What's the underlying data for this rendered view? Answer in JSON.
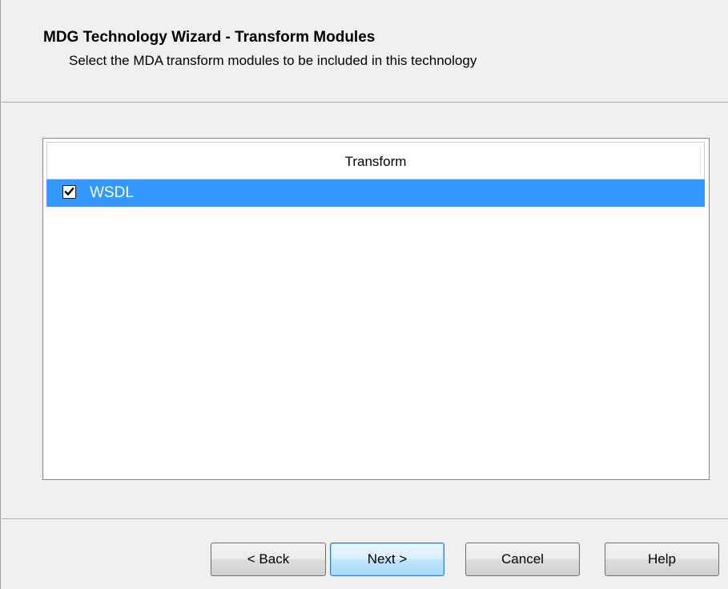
{
  "wizard": {
    "title": "MDG Technology Wizard - Transform Modules",
    "subtitle": "Select the MDA transform modules to be included in this technology"
  },
  "transform_list": {
    "column_header": "Transform",
    "items": [
      {
        "label": "WSDL",
        "checked": true,
        "selected": true
      }
    ]
  },
  "buttons": {
    "back": "< Back",
    "next": "Next >",
    "cancel": "Cancel",
    "help": "Help"
  },
  "colors": {
    "selection": "#3399ff",
    "window_bg": "#f0f0f0"
  },
  "icons": {
    "checkmark": "checkmark-icon"
  }
}
